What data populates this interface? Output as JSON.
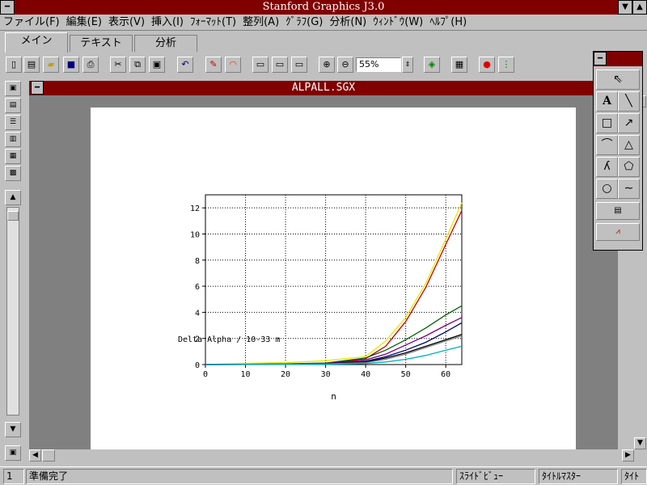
{
  "app": {
    "title": "Stanford Graphics J3.0"
  },
  "menu": [
    "ファイル(F)",
    "編集(E)",
    "表示(V)",
    "挿入(I)",
    "ﾌｫｰﾏｯﾄ(T)",
    "整列(A)",
    "ｸﾞﾗﾌ(G)",
    "分析(N)",
    "ｳｨﾝﾄﾞｳ(W)",
    "ﾍﾙﾌﾟ(H)"
  ],
  "tabs": [
    "メイン",
    "テキスト",
    "分析"
  ],
  "toolbar": {
    "zoom": "55%"
  },
  "document": {
    "title": "ALPALL.SGX"
  },
  "status": {
    "page": "1",
    "message": "準備完了",
    "slide_view": "ｽﾗｲﾄﾞﾋﾞｭｰ",
    "title_master": "ﾀｲﾄﾙﾏｽﾀｰ",
    "cut": "ﾀｲﾄ"
  },
  "palette": {
    "text_tool": "A"
  },
  "chart_data": {
    "type": "line",
    "xlabel": "n",
    "ylabel": "Delta Alpha / 10-33 m",
    "xlim": [
      0,
      64
    ],
    "ylim": [
      0,
      13
    ],
    "xticks": [
      0,
      10,
      20,
      30,
      40,
      50,
      60
    ],
    "yticks": [
      0,
      2,
      4,
      6,
      8,
      10,
      12
    ],
    "grid": true,
    "series": [
      {
        "color": "#e8e800",
        "x": [
          0,
          10,
          20,
          30,
          40,
          45,
          50,
          55,
          60,
          64
        ],
        "y": [
          0,
          0.1,
          0.15,
          0.3,
          0.6,
          1.8,
          3.6,
          6.2,
          9.6,
          12.4
        ]
      },
      {
        "color": "#c00000",
        "x": [
          0,
          10,
          20,
          30,
          40,
          45,
          50,
          55,
          60,
          64
        ],
        "y": [
          0,
          0.02,
          0.05,
          0.1,
          0.45,
          1.4,
          3.3,
          5.9,
          9.2,
          11.8
        ]
      },
      {
        "color": "#006400",
        "x": [
          0,
          10,
          20,
          30,
          40,
          45,
          50,
          55,
          60,
          64
        ],
        "y": [
          0,
          0.02,
          0.05,
          0.12,
          0.5,
          1.1,
          1.9,
          2.8,
          3.8,
          4.5
        ]
      },
      {
        "color": "#800080",
        "x": [
          0,
          10,
          20,
          30,
          40,
          45,
          50,
          55,
          60,
          64
        ],
        "y": [
          0,
          0.01,
          0.03,
          0.08,
          0.35,
          0.8,
          1.5,
          2.2,
          3.0,
          3.6
        ]
      },
      {
        "color": "#000080",
        "x": [
          0,
          10,
          20,
          30,
          40,
          45,
          50,
          55,
          60,
          64
        ],
        "y": [
          0,
          0.01,
          0.02,
          0.06,
          0.25,
          0.6,
          1.1,
          1.7,
          2.5,
          3.2
        ]
      },
      {
        "color": "#000000",
        "x": [
          0,
          10,
          20,
          30,
          40,
          45,
          50,
          55,
          60,
          64
        ],
        "y": [
          0,
          0.01,
          0.02,
          0.05,
          0.2,
          0.5,
          0.9,
          1.4,
          1.9,
          2.3
        ]
      },
      {
        "color": "#808080",
        "x": [
          0,
          10,
          20,
          30,
          40,
          45,
          50,
          55,
          60,
          64
        ],
        "y": [
          0,
          0.01,
          0.02,
          0.05,
          0.15,
          0.4,
          0.8,
          1.3,
          1.8,
          2.2
        ]
      },
      {
        "color": "#00b0c0",
        "x": [
          0,
          10,
          20,
          30,
          40,
          45,
          50,
          55,
          60,
          64
        ],
        "y": [
          0,
          0.0,
          0.01,
          0.02,
          0.08,
          0.2,
          0.4,
          0.7,
          1.1,
          1.4
        ]
      }
    ]
  }
}
